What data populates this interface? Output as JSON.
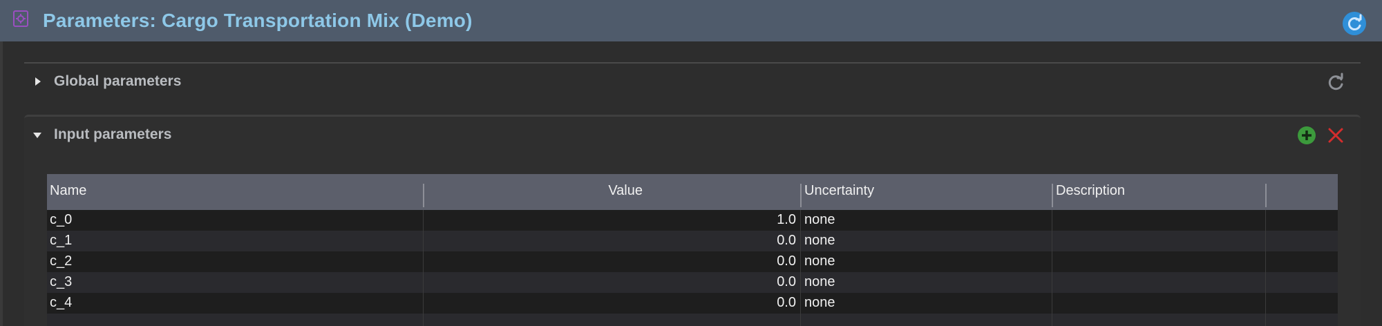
{
  "window": {
    "title": "Parameters: Cargo Transportation Mix (Demo)"
  },
  "sections": {
    "global": {
      "label": "Global parameters",
      "expanded": false
    },
    "input": {
      "label": "Input parameters",
      "expanded": true
    }
  },
  "table": {
    "columns": [
      "Name",
      "Value",
      "Uncertainty",
      "Description"
    ],
    "rows": [
      {
        "name": "c_0",
        "value": "1.0",
        "uncertainty": "none",
        "description": ""
      },
      {
        "name": "c_1",
        "value": "0.0",
        "uncertainty": "none",
        "description": ""
      },
      {
        "name": "c_2",
        "value": "0.0",
        "uncertainty": "none",
        "description": ""
      },
      {
        "name": "c_3",
        "value": "0.0",
        "uncertainty": "none",
        "description": ""
      },
      {
        "name": "c_4",
        "value": "0.0",
        "uncertainty": "none",
        "description": ""
      }
    ]
  },
  "icons": {
    "title": "parameters-icon",
    "title_refresh": "refresh-icon",
    "global_refresh": "refresh-icon",
    "add": "add-icon",
    "delete": "delete-icon"
  },
  "colors": {
    "title_bar": "#4f5b6b",
    "title_text": "#8ec8e8",
    "background": "#2d2d2d",
    "table_header": "#5c5f6b",
    "add_green": "#3c9a3c",
    "delete_red": "#d42d2d",
    "refresh_blue": "#2f8fd8"
  }
}
